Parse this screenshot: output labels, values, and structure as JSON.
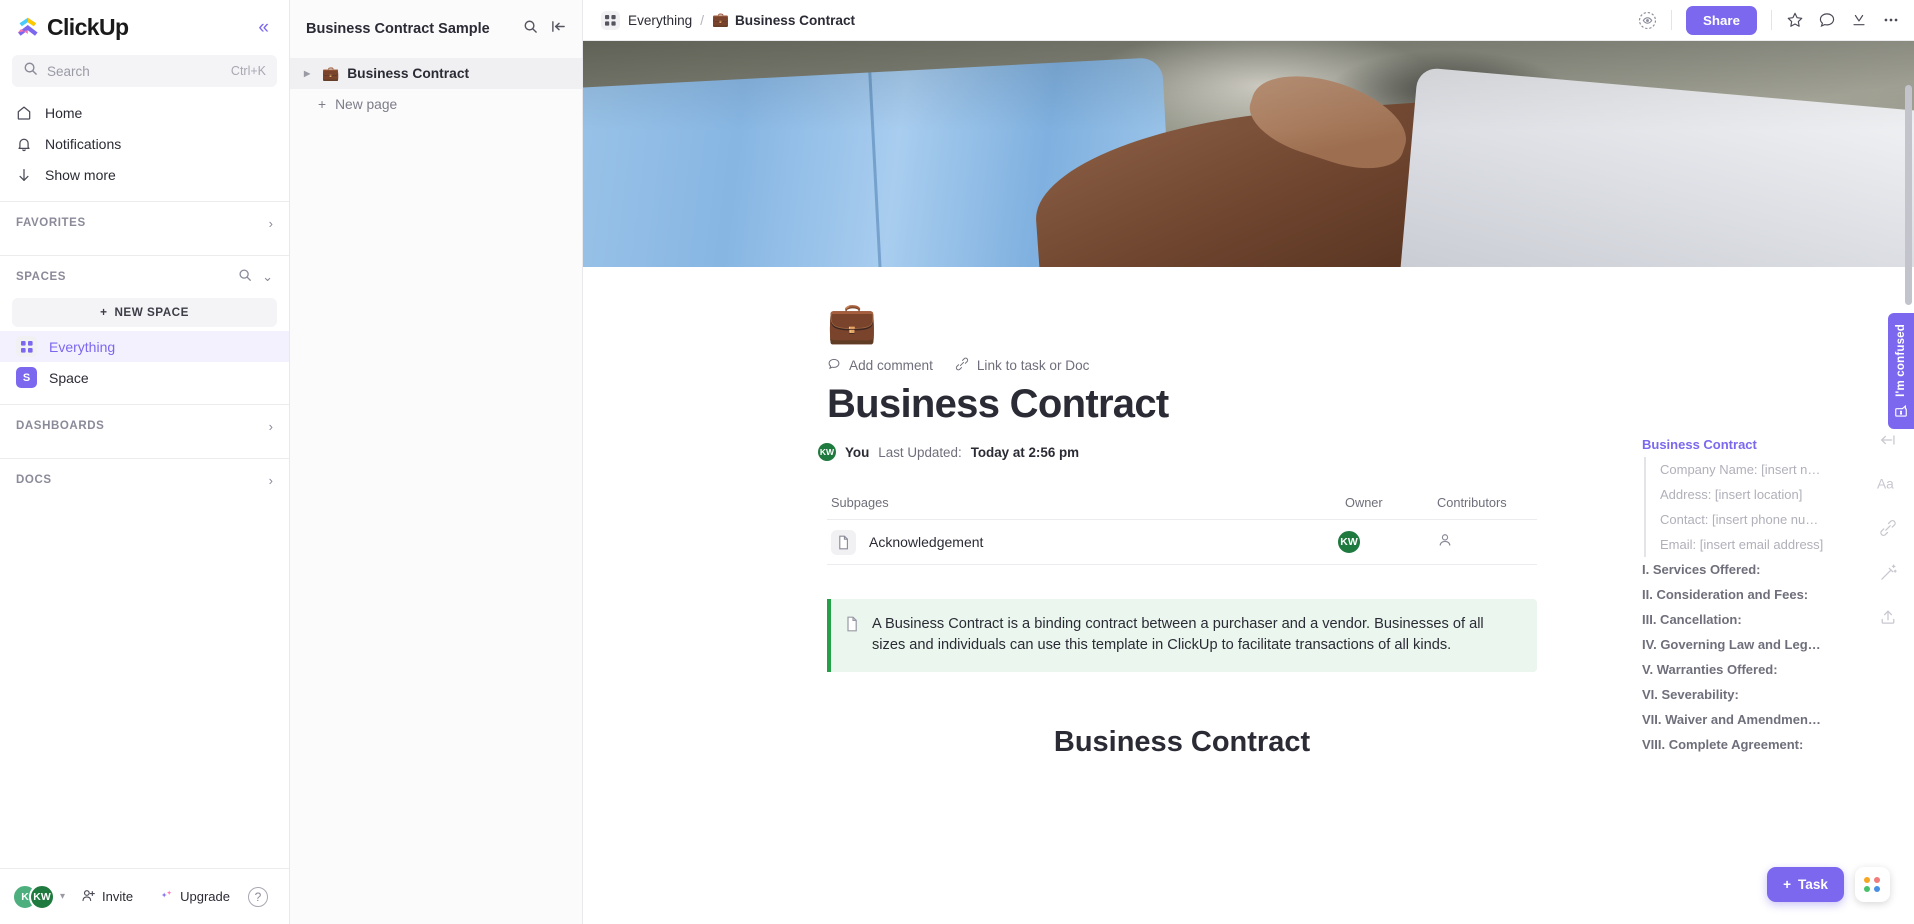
{
  "sidebar": {
    "logo_text": "ClickUp",
    "collapse_icon": "chevron-double-left-icon",
    "search": {
      "placeholder": "Search",
      "shortcut": "Ctrl+K",
      "icon": "search-icon"
    },
    "nav": [
      {
        "label": "Home",
        "icon": "home-icon"
      },
      {
        "label": "Notifications",
        "icon": "bell-icon"
      },
      {
        "label": "Show more",
        "icon": "arrow-down-icon"
      }
    ],
    "favorites": {
      "label": "FAVORITES",
      "chevron": "chevron-right-icon"
    },
    "spaces": {
      "label": "SPACES",
      "search_icon": "search-icon",
      "chevron": "chevron-down-icon"
    },
    "new_space": "NEW SPACE",
    "space_items": [
      {
        "label": "Everything",
        "icon": "grid-icon",
        "active": true
      },
      {
        "label": "Space",
        "badge": "S",
        "active": false
      }
    ],
    "dashboards": {
      "label": "DASHBOARDS",
      "chevron": "chevron-right-icon"
    },
    "docs": {
      "label": "DOCS",
      "chevron": "chevron-right-icon"
    },
    "bottom": {
      "avatar1": "K",
      "avatar2": "KW",
      "invite": "Invite",
      "upgrade": "Upgrade",
      "help": "?"
    }
  },
  "docpanel": {
    "title": "Business Contract Sample",
    "search_icon": "search-icon",
    "collapse_icon": "panel-collapse-icon",
    "page": {
      "label": "Business Contract",
      "emoji": "💼"
    },
    "new_page": "New page"
  },
  "topbar": {
    "breadcrumb_root": "Everything",
    "breadcrumb_sep": "/",
    "breadcrumb_current": "Business Contract",
    "breadcrumb_emoji": "💼",
    "privacy_icon": "privacy-eye-icon",
    "share_label": "Share",
    "star_icon": "star-icon",
    "comment_icon": "comment-icon",
    "export_icon": "export-icon",
    "more_icon": "more-horizontal-icon"
  },
  "doc": {
    "emoji": "💼",
    "add_comment": "Add comment",
    "link_task": "Link to task or Doc",
    "title": "Business Contract",
    "author": "You",
    "updated_label": "Last Updated:",
    "updated_value": "Today at 2:56 pm",
    "author_avatar": "KW",
    "subpages": {
      "columns": [
        "Subpages",
        "Owner",
        "Contributors"
      ],
      "rows": [
        {
          "name": "Acknowledgement",
          "owner": "KW",
          "contributors_icon": "person-icon"
        }
      ]
    },
    "callout": "A Business Contract is a binding contract between a purchaser and a vendor. Businesses of all sizes and individuals can use this template in ClickUp to facilitate transactions of all kinds.",
    "heading": "Business Contract"
  },
  "outline": [
    {
      "label": "Business Contract",
      "type": "active"
    },
    {
      "label": "Company Name: [insert n…",
      "type": "sub"
    },
    {
      "label": "Address: [insert location]",
      "type": "sub"
    },
    {
      "label": "Contact: [insert phone nu…",
      "type": "sub"
    },
    {
      "label": "Email: [insert email address]",
      "type": "sub"
    },
    {
      "label": "I. Services Offered:",
      "type": "head2"
    },
    {
      "label": "II. Consideration and Fees:",
      "type": "head2"
    },
    {
      "label": "III. Cancellation:",
      "type": "head2"
    },
    {
      "label": "IV. Governing Law and Leg…",
      "type": "head2"
    },
    {
      "label": "V. Warranties Offered:",
      "type": "head2"
    },
    {
      "label": "VI. Severability:",
      "type": "head2"
    },
    {
      "label": "VII. Waiver and Amendmen…",
      "type": "head2"
    },
    {
      "label": "VIII. Complete Agreement:",
      "type": "head2"
    }
  ],
  "rail": [
    {
      "icon": "collapse-left-icon"
    },
    {
      "icon": "font-size-icon",
      "label": "Aa"
    },
    {
      "icon": "link-icon"
    },
    {
      "icon": "magic-wand-icon"
    },
    {
      "icon": "share-upload-icon"
    }
  ],
  "feedback": {
    "label": "I'm confused",
    "icon": "feedback-icon"
  },
  "fabs": {
    "task_label": "Task",
    "plus": "+",
    "apps_icon": "apps-grid-icon"
  },
  "colors": {
    "accent": "#7b68ee",
    "callout_border": "#24a148",
    "callout_bg": "#eaf6ee",
    "avatar_green": "#1f7a3f"
  }
}
